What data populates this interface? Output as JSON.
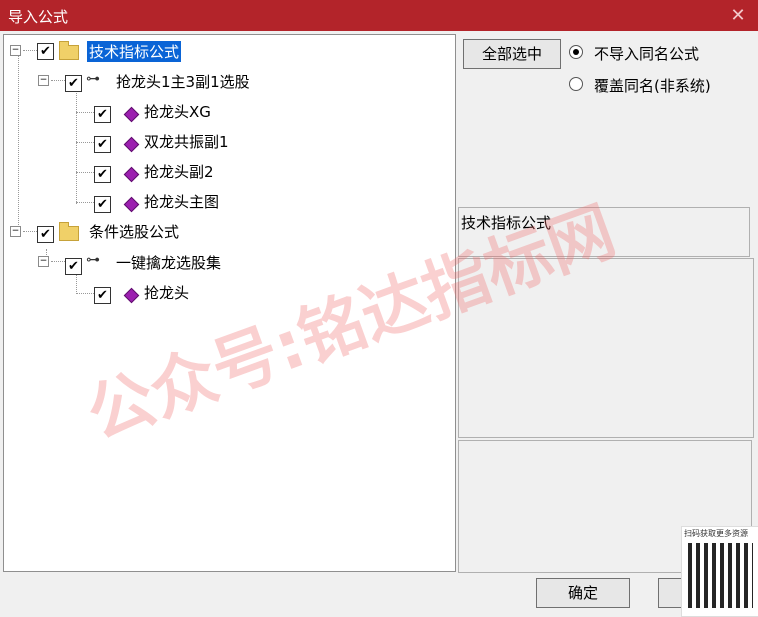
{
  "window": {
    "title": "导入公式"
  },
  "tree": {
    "nodes": [
      {
        "label": "技术指标公式"
      },
      {
        "label": "抢龙头1主3副1选股"
      },
      {
        "label": "抢龙头XG"
      },
      {
        "label": "双龙共振副1"
      },
      {
        "label": "抢龙头副2"
      },
      {
        "label": "抢龙头主图"
      },
      {
        "label": "条件选股公式"
      },
      {
        "label": "一键擒龙选股集"
      },
      {
        "label": "抢龙头"
      }
    ]
  },
  "buttons": {
    "select_all": "全部选中",
    "ok": "确定"
  },
  "options": {
    "no_import_same": "不导入同名公式",
    "overwrite_same": "覆盖同名(非系统)"
  },
  "info": {
    "category": "技术指标公式"
  },
  "watermark": {
    "text": "公众号:铭达指标网"
  },
  "qr": {
    "caption": "扫码获取更多资源"
  }
}
